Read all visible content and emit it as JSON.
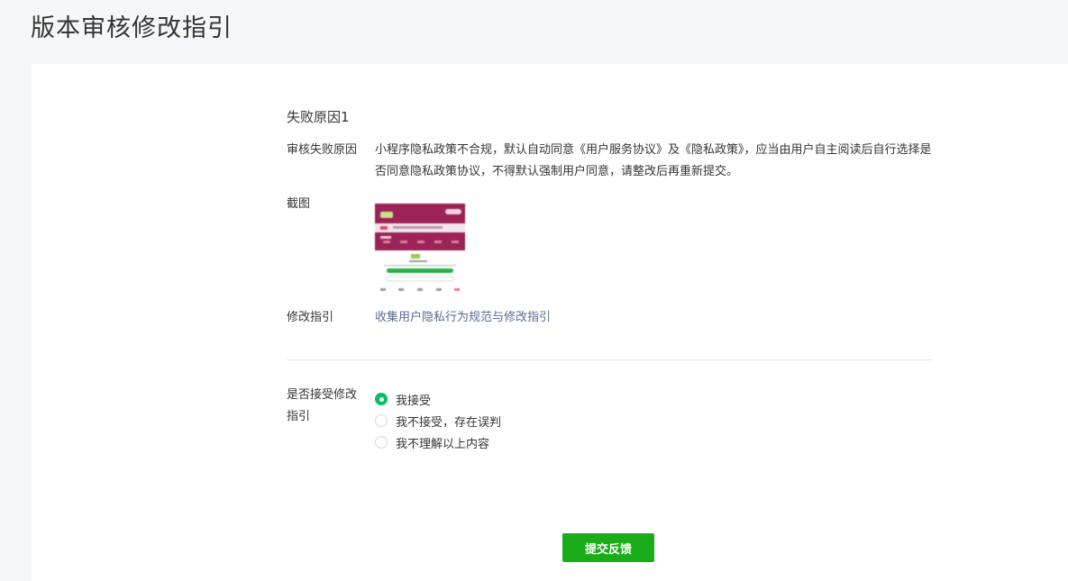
{
  "page": {
    "title": "版本审核修改指引"
  },
  "failure": {
    "section_title": "失败原因1",
    "reason_label": "审核失败原因",
    "reason_text": "小程序隐私政策不合规，默认自动同意《用户服务协议》及《隐私政策》，应当由用户自主阅读后自行选择是否同意隐私政策协议，不得默认强制用户同意，请整改后再重新提交。",
    "screenshot_label": "截图",
    "guide_label": "修改指引",
    "guide_link": "收集用户隐私行为规范与修改指引"
  },
  "accept": {
    "label": "是否接受修改指引",
    "options": [
      {
        "label": "我接受",
        "checked": true
      },
      {
        "label": "我不接受，存在误判",
        "checked": false
      },
      {
        "label": "我不理解以上内容",
        "checked": false
      }
    ]
  },
  "submit_label": "提交反馈",
  "colors": {
    "accent_green": "#07c160",
    "button_green": "#1aad19",
    "link_blue": "#576b95",
    "thumbnail_header": "#9b2357"
  }
}
